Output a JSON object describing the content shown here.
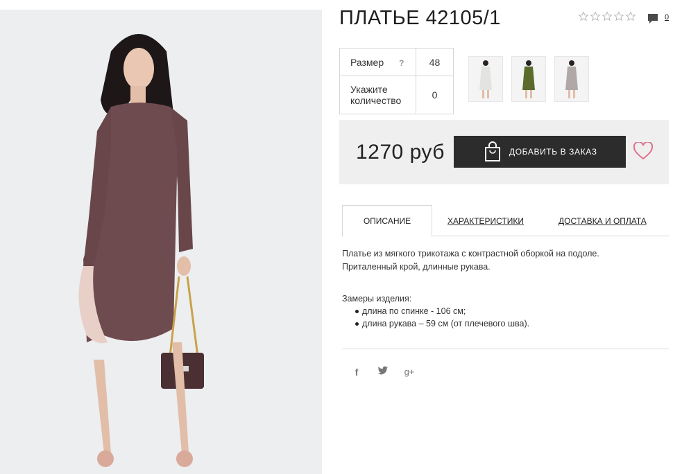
{
  "product": {
    "title": "ПЛАТЬЕ 42105/1",
    "rating_stars": 0,
    "rating_max": 5,
    "comment_count": "0"
  },
  "options": {
    "size_label": "Размер",
    "size_help": "?",
    "size_value": "48",
    "qty_label_line1": "Укажите",
    "qty_label_line2": "количество",
    "qty_value": "0"
  },
  "thumbnails": [
    {
      "name": "thumb-white-dress",
      "color": "#e6e6e4"
    },
    {
      "name": "thumb-green-dress",
      "color": "#5b6b2c"
    },
    {
      "name": "thumb-grey-dress",
      "color": "#b0a8a6"
    }
  ],
  "purchase": {
    "price": "1270 руб",
    "order_label": "ДОБАВИТЬ В ЗАКАЗ"
  },
  "tabs": [
    {
      "label": "ОПИСАНИЕ",
      "active": true
    },
    {
      "label": "ХАРАКТЕРИСТИКИ",
      "active": false
    },
    {
      "label": "ДОСТАВКА И ОПЛАТА",
      "active": false
    }
  ],
  "description": {
    "line1": "Платье из мягкого трикотажа с контрастной оборкой на подоле.",
    "line2": "Приталенный крой, длинные рукава.",
    "measures_title": "Замеры изделия:",
    "measures": [
      "длина по спинке - 106 см;",
      "длина рукава – 59 см (от плечевого шва)."
    ]
  },
  "share": {
    "facebook": "f",
    "twitter": "t",
    "gplus": "g+"
  },
  "colors": {
    "dress": "#6e4b4e",
    "button": "#2c2c2c",
    "heart": "#e0708a",
    "buy_box": "#efefef"
  }
}
